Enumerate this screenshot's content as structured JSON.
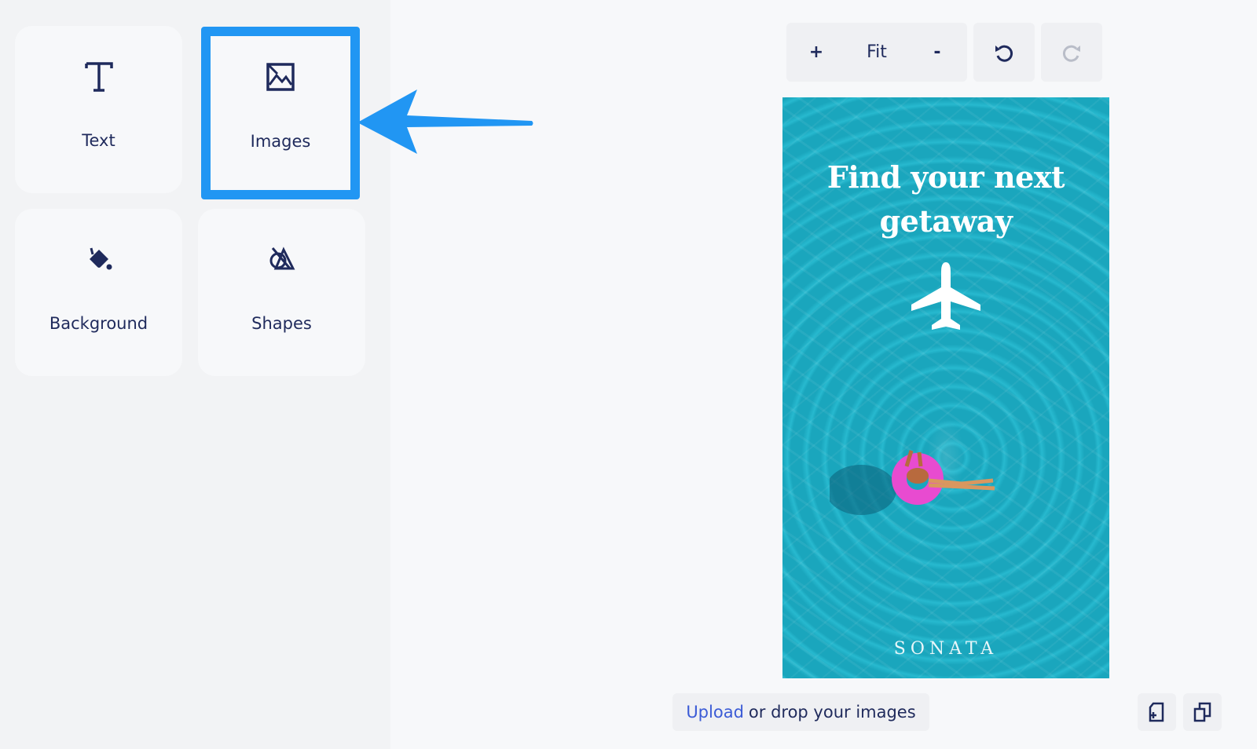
{
  "sidebar": {
    "tiles": [
      {
        "label": "Text",
        "icon": "text-icon"
      },
      {
        "label": "Images",
        "icon": "image-icon",
        "selected": true
      },
      {
        "label": "Background",
        "icon": "paint-bucket-icon"
      },
      {
        "label": "Shapes",
        "icon": "shapes-icon"
      }
    ]
  },
  "toolbar": {
    "zoom_in": "+",
    "fit": "Fit",
    "zoom_out": "-",
    "undo_icon": "undo-icon",
    "redo_icon": "redo-icon"
  },
  "canvas": {
    "headline": "Find your next getaway",
    "brand": "SONATA"
  },
  "upload": {
    "link": "Upload",
    "text": "or drop your images"
  },
  "colors": {
    "accent": "#2196f3",
    "text": "#1f2a5c",
    "link": "#3b5bd6",
    "water": "#1aa6bd"
  }
}
